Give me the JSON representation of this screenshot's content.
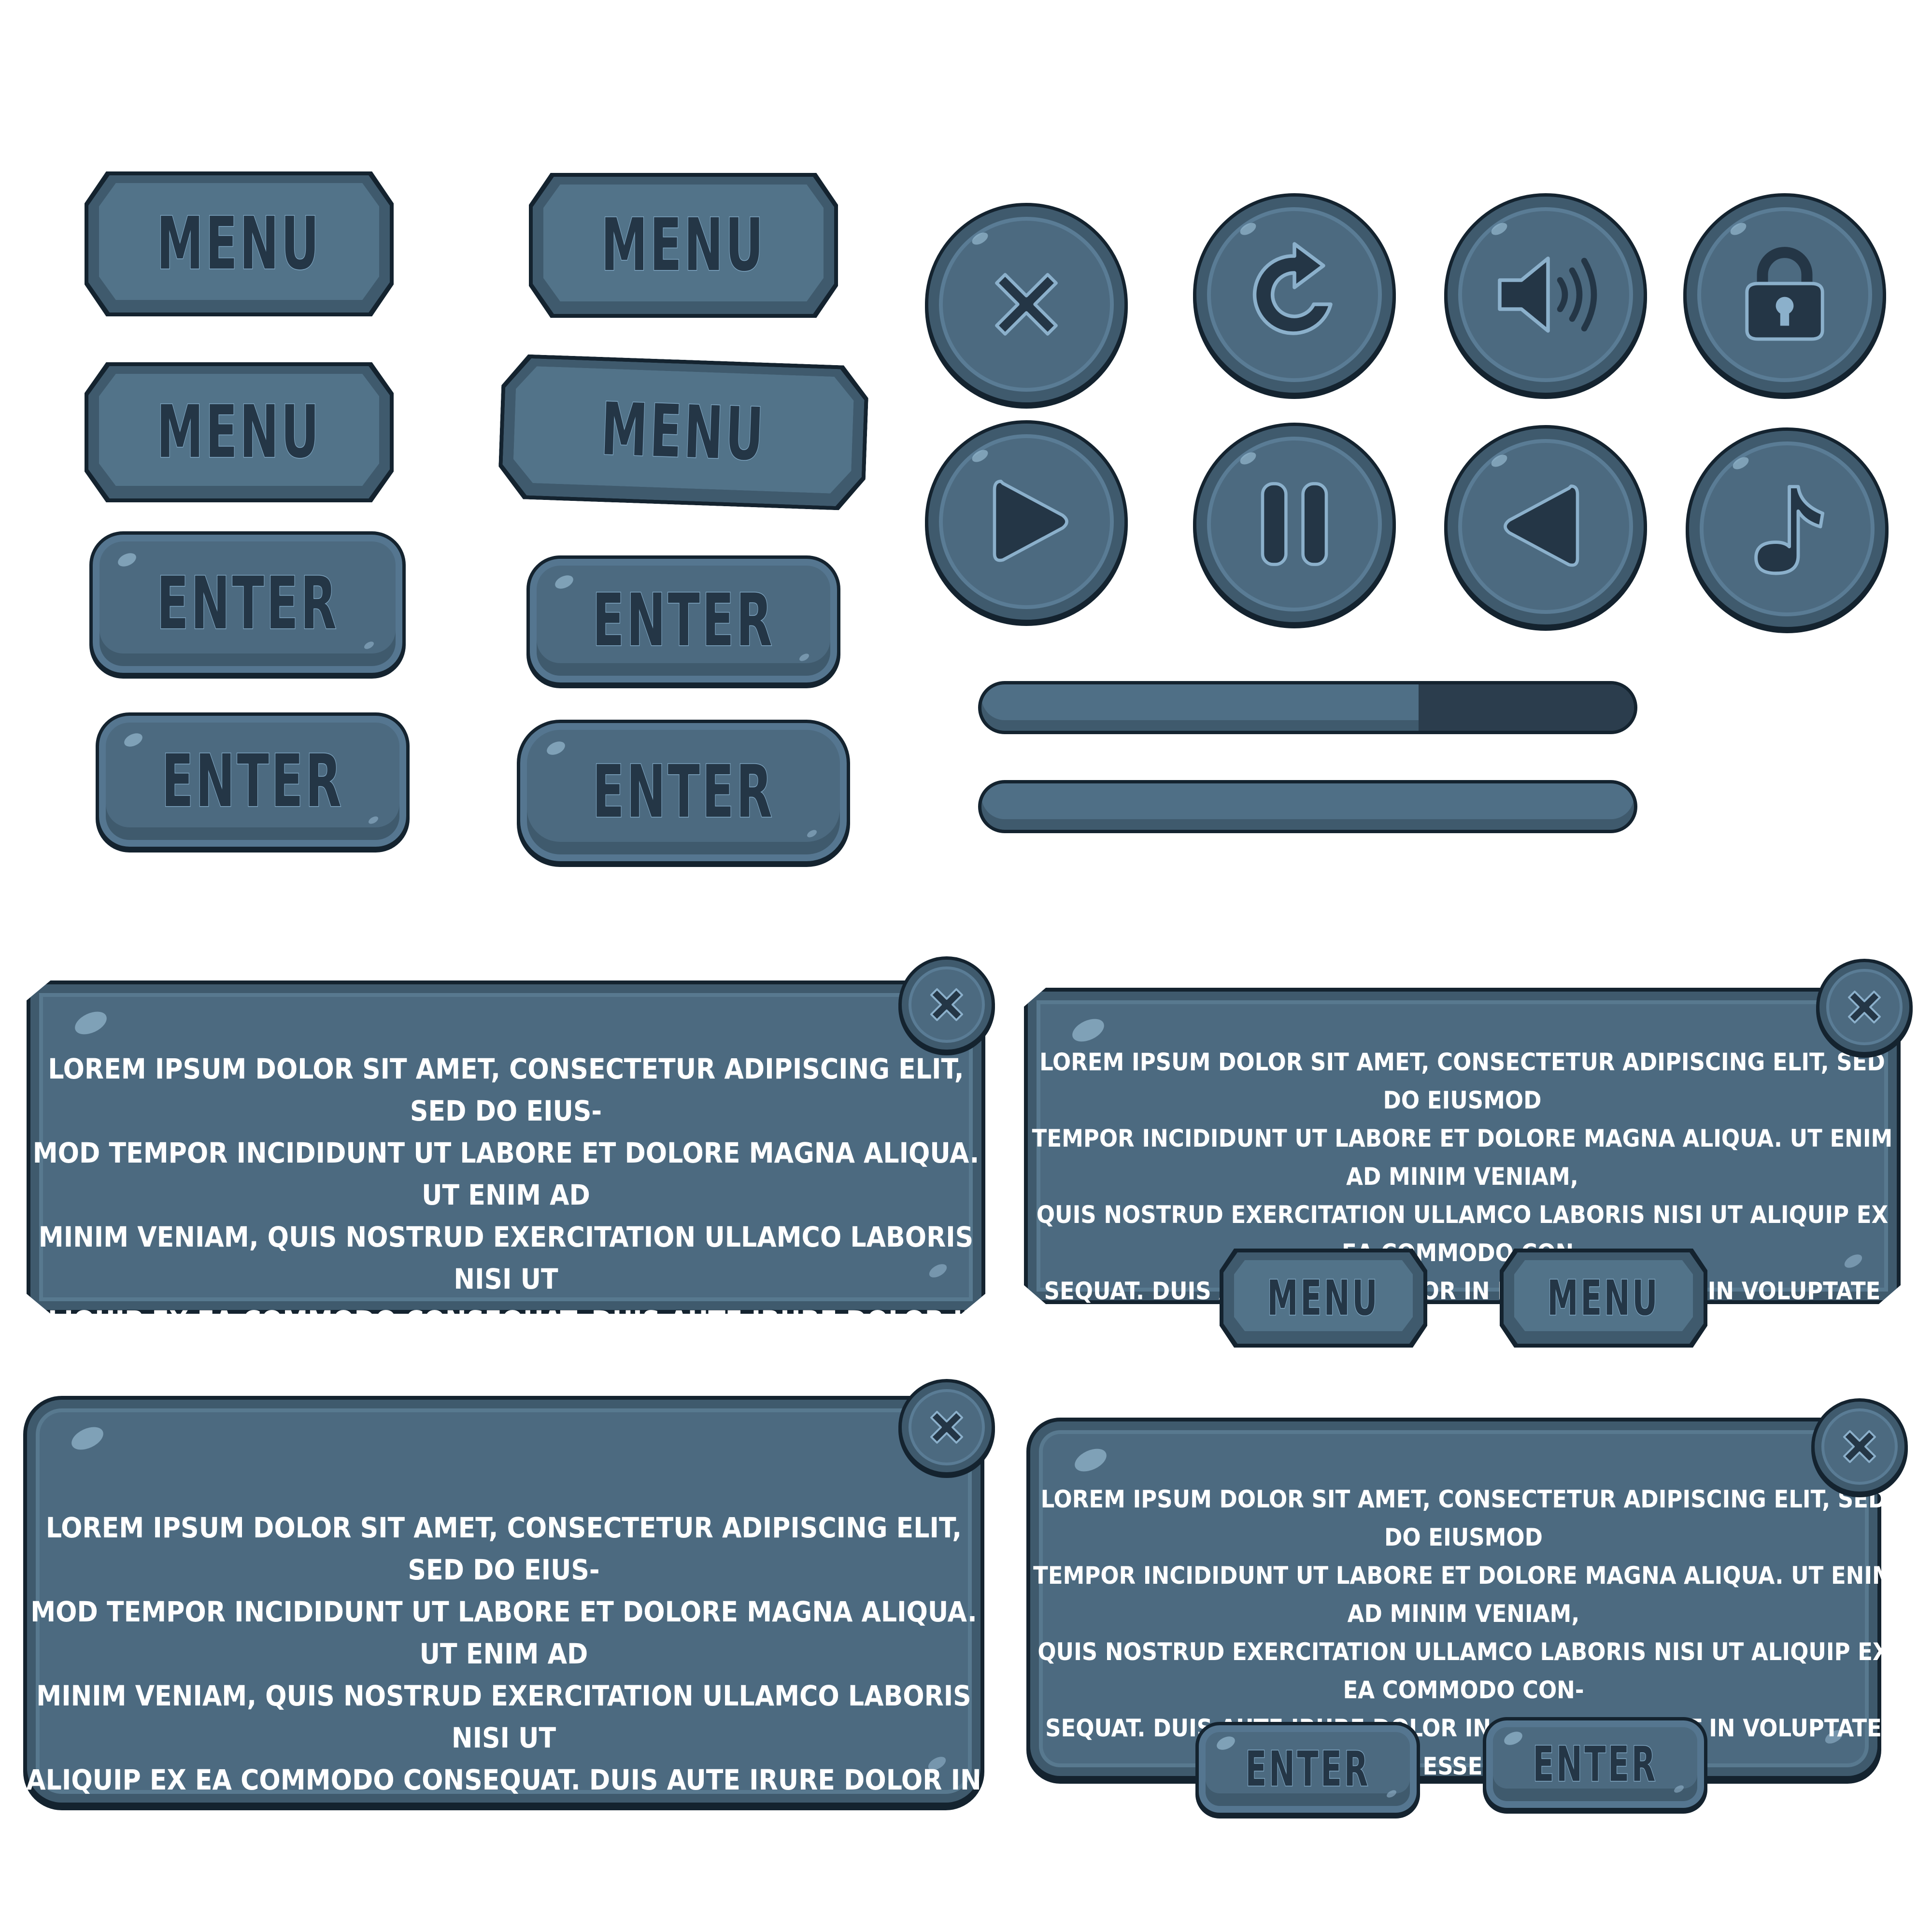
{
  "buttons": {
    "menu_label": "MENU",
    "enter_label": "ENTER"
  },
  "icons": {
    "close": "close-icon",
    "restart": "restart-icon",
    "sound": "sound-icon",
    "lock": "lock-icon",
    "play": "play-icon",
    "pause": "pause-icon",
    "back": "back-icon",
    "music": "music-note-icon"
  },
  "progress": {
    "bar1_fill": 0.67,
    "bar2_fill": 1.0
  },
  "panels": {
    "text_wide": "LOREM IPSUM DOLOR SIT AMET, CONSECTETUR ADIPISCING ELIT, SED DO EIUS-\nMOD TEMPOR INCIDIDUNT UT LABORE ET DOLORE MAGNA ALIQUA. UT ENIM AD\nMINIM VENIAM, QUIS NOSTRUD EXERCITATION ULLAMCO LABORIS NISI UT\nALIQUIP EX EA COMMODO CONSEQUAT. DUIS AUTE IRURE DOLOR IN REPREHEN-\nDERIT IN VOLUPTATE VELIT ESSE CILLUM DOLORE EU FUGIAT NULLA PARIATU",
    "text_narrow": "LOREM IPSUM DOLOR SIT AMET, CONSECTETUR ADIPISCING ELIT, SED DO EIUSMOD\nTEMPOR INCIDIDUNT UT LABORE ET DOLORE MAGNA ALIQUA. UT ENIM AD MINIM VENIAM,\nQUIS NOSTRUD EXERCITATION ULLAMCO LABORIS NISI UT ALIQUIP EX EA COMMODO CON-\nSEQUAT. DUIS AUTE IRURE DOLOR IN REPREHENDERIT IN VOLUPTATE VELIT ESSE CILLUM\nDOLORE EU FUGIAT NULLA PARIATU"
  },
  "colors": {
    "stone": "#4c6a80",
    "outline": "#14232f",
    "text_dark": "#243646",
    "highlight": "#7fa6c2",
    "bar_empty": "#2b3d4d"
  }
}
